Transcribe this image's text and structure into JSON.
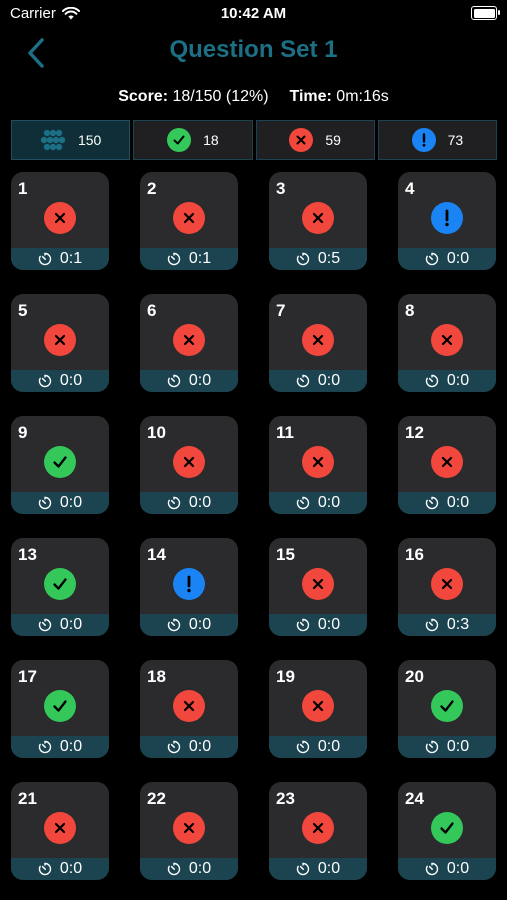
{
  "status_bar": {
    "carrier": "Carrier",
    "time": "10:42 AM"
  },
  "header": {
    "title": "Question Set 1"
  },
  "score": {
    "score_label": "Score:",
    "score_value": "18/150 (12%)",
    "time_label": "Time:",
    "time_value": "0m:16s"
  },
  "filters": [
    {
      "icon": "all-questions-icon",
      "count": "150"
    },
    {
      "icon": "correct-icon",
      "count": "18"
    },
    {
      "icon": "incorrect-icon",
      "count": "59"
    },
    {
      "icon": "unanswered-icon",
      "count": "73"
    }
  ],
  "colors": {
    "correct": "#34c759",
    "incorrect": "#f2473c",
    "unanswered": "#1a84f5",
    "accent": "#1c6f84",
    "card_footer": "#1b4450"
  },
  "questions": [
    {
      "number": "1",
      "status": "incorrect",
      "time": "0:1"
    },
    {
      "number": "2",
      "status": "incorrect",
      "time": "0:1"
    },
    {
      "number": "3",
      "status": "incorrect",
      "time": "0:5"
    },
    {
      "number": "4",
      "status": "unanswered",
      "time": "0:0"
    },
    {
      "number": "5",
      "status": "incorrect",
      "time": "0:0"
    },
    {
      "number": "6",
      "status": "incorrect",
      "time": "0:0"
    },
    {
      "number": "7",
      "status": "incorrect",
      "time": "0:0"
    },
    {
      "number": "8",
      "status": "incorrect",
      "time": "0:0"
    },
    {
      "number": "9",
      "status": "correct",
      "time": "0:0"
    },
    {
      "number": "10",
      "status": "incorrect",
      "time": "0:0"
    },
    {
      "number": "11",
      "status": "incorrect",
      "time": "0:0"
    },
    {
      "number": "12",
      "status": "incorrect",
      "time": "0:0"
    },
    {
      "number": "13",
      "status": "correct",
      "time": "0:0"
    },
    {
      "number": "14",
      "status": "unanswered",
      "time": "0:0"
    },
    {
      "number": "15",
      "status": "incorrect",
      "time": "0:0"
    },
    {
      "number": "16",
      "status": "incorrect",
      "time": "0:3"
    },
    {
      "number": "17",
      "status": "correct",
      "time": "0:0"
    },
    {
      "number": "18",
      "status": "incorrect",
      "time": "0:0"
    },
    {
      "number": "19",
      "status": "incorrect",
      "time": "0:0"
    },
    {
      "number": "20",
      "status": "correct",
      "time": "0:0"
    },
    {
      "number": "21",
      "status": "incorrect",
      "time": "0:0"
    },
    {
      "number": "22",
      "status": "incorrect",
      "time": "0:0"
    },
    {
      "number": "23",
      "status": "incorrect",
      "time": "0:0"
    },
    {
      "number": "24",
      "status": "correct",
      "time": "0:0"
    }
  ]
}
